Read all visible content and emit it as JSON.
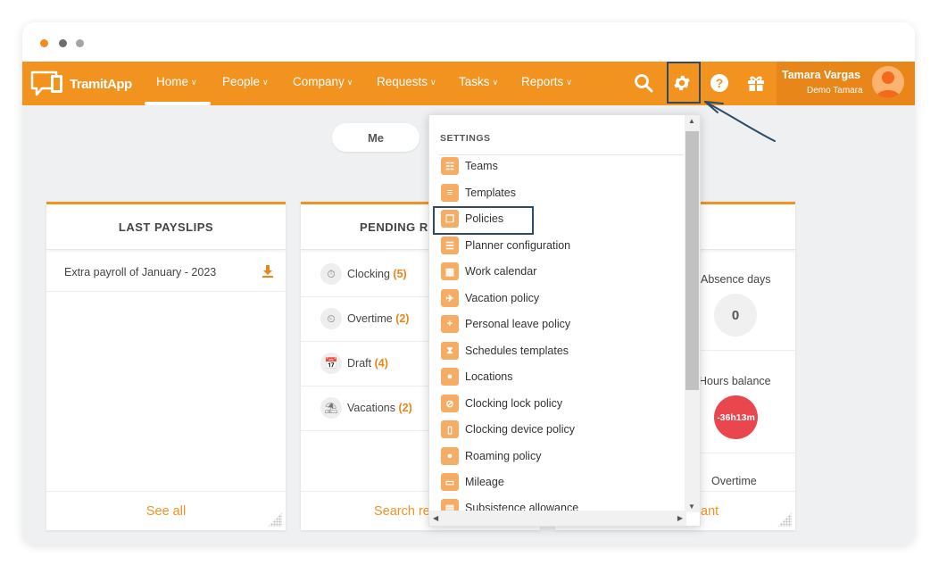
{
  "window": {
    "dots": [
      "orange",
      "gray",
      "lightgray"
    ]
  },
  "navbar": {
    "logo_text": "TramitApp",
    "items": [
      {
        "label": "Home"
      },
      {
        "label": "People"
      },
      {
        "label": "Company"
      },
      {
        "label": "Requests"
      },
      {
        "label": "Tasks"
      },
      {
        "label": "Reports"
      }
    ],
    "icons": [
      "search-icon",
      "gear-icon",
      "help-icon",
      "gift-icon"
    ],
    "user": {
      "name": "Tamara Vargas",
      "subtitle": "Demo Tamara"
    }
  },
  "main": {
    "toggle_label": "Me",
    "payslips_card": {
      "title": "LAST PAYSLIPS",
      "items": [
        {
          "label": "Extra payroll of January - 2023"
        }
      ],
      "footer": "See all"
    },
    "pending_card": {
      "title": "PENDING RE",
      "rows": [
        {
          "label": "Clocking",
          "count": "(5)",
          "icon": "stopwatch-icon"
        },
        {
          "label": "Overtime",
          "count": "(2)",
          "icon": "overtime-icon"
        },
        {
          "label": "Draft",
          "count": "(4)",
          "icon": "calendar-draft-icon"
        },
        {
          "label": "Vacations",
          "count": "(2)",
          "icon": "beach-umbrella-icon"
        }
      ],
      "footer": "Search re"
    },
    "stats_card": {
      "absence_label": "Absence days",
      "absence_value": "0",
      "hours_label": "Hours balance",
      "hours_value": "-36h13m",
      "overtime_label": "Overtime",
      "footer": "ant"
    }
  },
  "settings_menu": {
    "title": "SETTINGS",
    "items": [
      {
        "label": "Teams",
        "icon": "org-chart-icon"
      },
      {
        "label": "Templates",
        "icon": "document-icon"
      },
      {
        "label": "Policies",
        "icon": "policy-icon"
      },
      {
        "label": "Planner configuration",
        "icon": "planner-icon"
      },
      {
        "label": "Work calendar",
        "icon": "calendar-icon"
      },
      {
        "label": "Vacation policy",
        "icon": "plane-icon"
      },
      {
        "label": "Personal leave policy",
        "icon": "leave-icon"
      },
      {
        "label": "Schedules templates",
        "icon": "hourglass-icon"
      },
      {
        "label": "Locations",
        "icon": "location-pin-icon"
      },
      {
        "label": "Clocking lock policy",
        "icon": "lock-circle-icon"
      },
      {
        "label": "Clocking device policy",
        "icon": "device-icon"
      },
      {
        "label": "Roaming policy",
        "icon": "roaming-pin-icon"
      },
      {
        "label": "Mileage",
        "icon": "car-icon"
      },
      {
        "label": "Subsistence allowance",
        "icon": "allowance-icon"
      }
    ]
  },
  "colors": {
    "brand": "#f2931f",
    "highlight_border": "#2f4a66",
    "negative": "#e9474d"
  }
}
